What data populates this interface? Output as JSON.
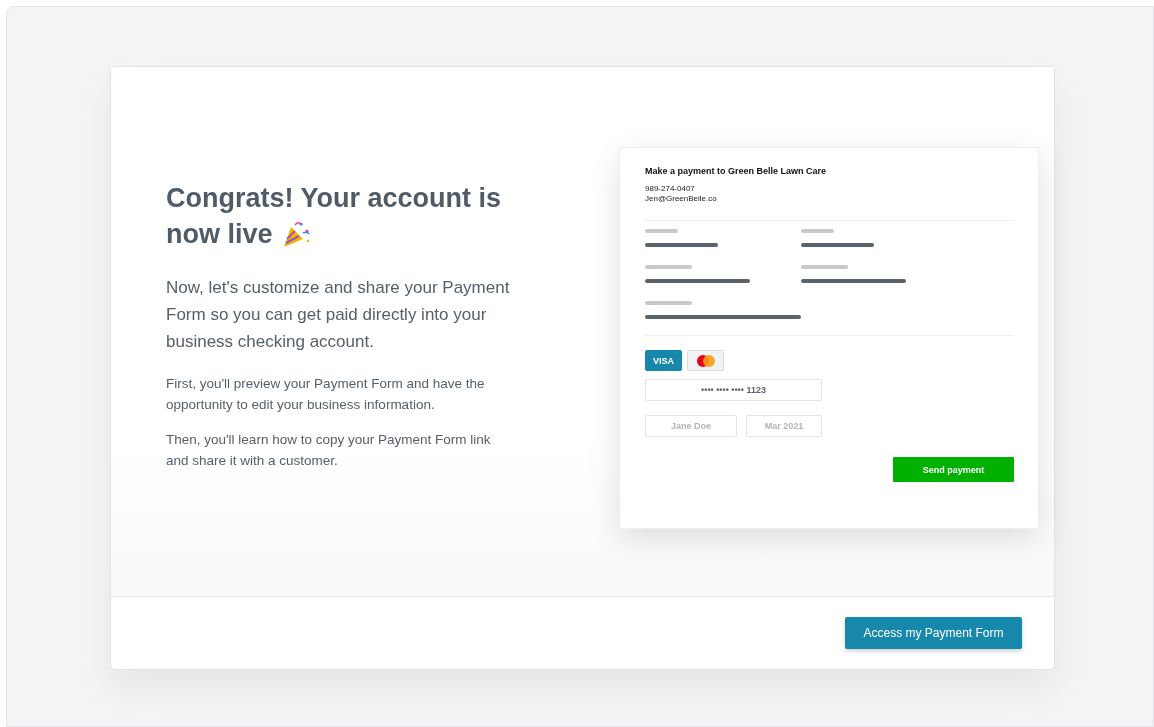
{
  "heading_lines": [
    "Congrats! Your account is",
    "now live"
  ],
  "intro": "Now, let's customize and share your Payment Form so you can get paid directly into your business checking account.",
  "paragraphs": [
    "First, you'll preview your Payment Form and have the opportunity to edit your business information.",
    "Then, you'll learn how to copy your Payment Form link and share it with a customer."
  ],
  "preview": {
    "title": "Make a payment to Green Belle Lawn Care",
    "phone": "989-274-0407",
    "email": "Jen@GreenBelle.co",
    "card_brands": [
      {
        "kind": "visa",
        "label": "VISA",
        "selected": true
      },
      {
        "kind": "mastercard",
        "selected": false
      }
    ],
    "card_number": "•••• •••• •••• 1123",
    "name_placeholder": "Jane Doe",
    "expiry_placeholder": "Mar 2021",
    "submit": "Send payment"
  },
  "footer_button": "Access my Payment Form"
}
